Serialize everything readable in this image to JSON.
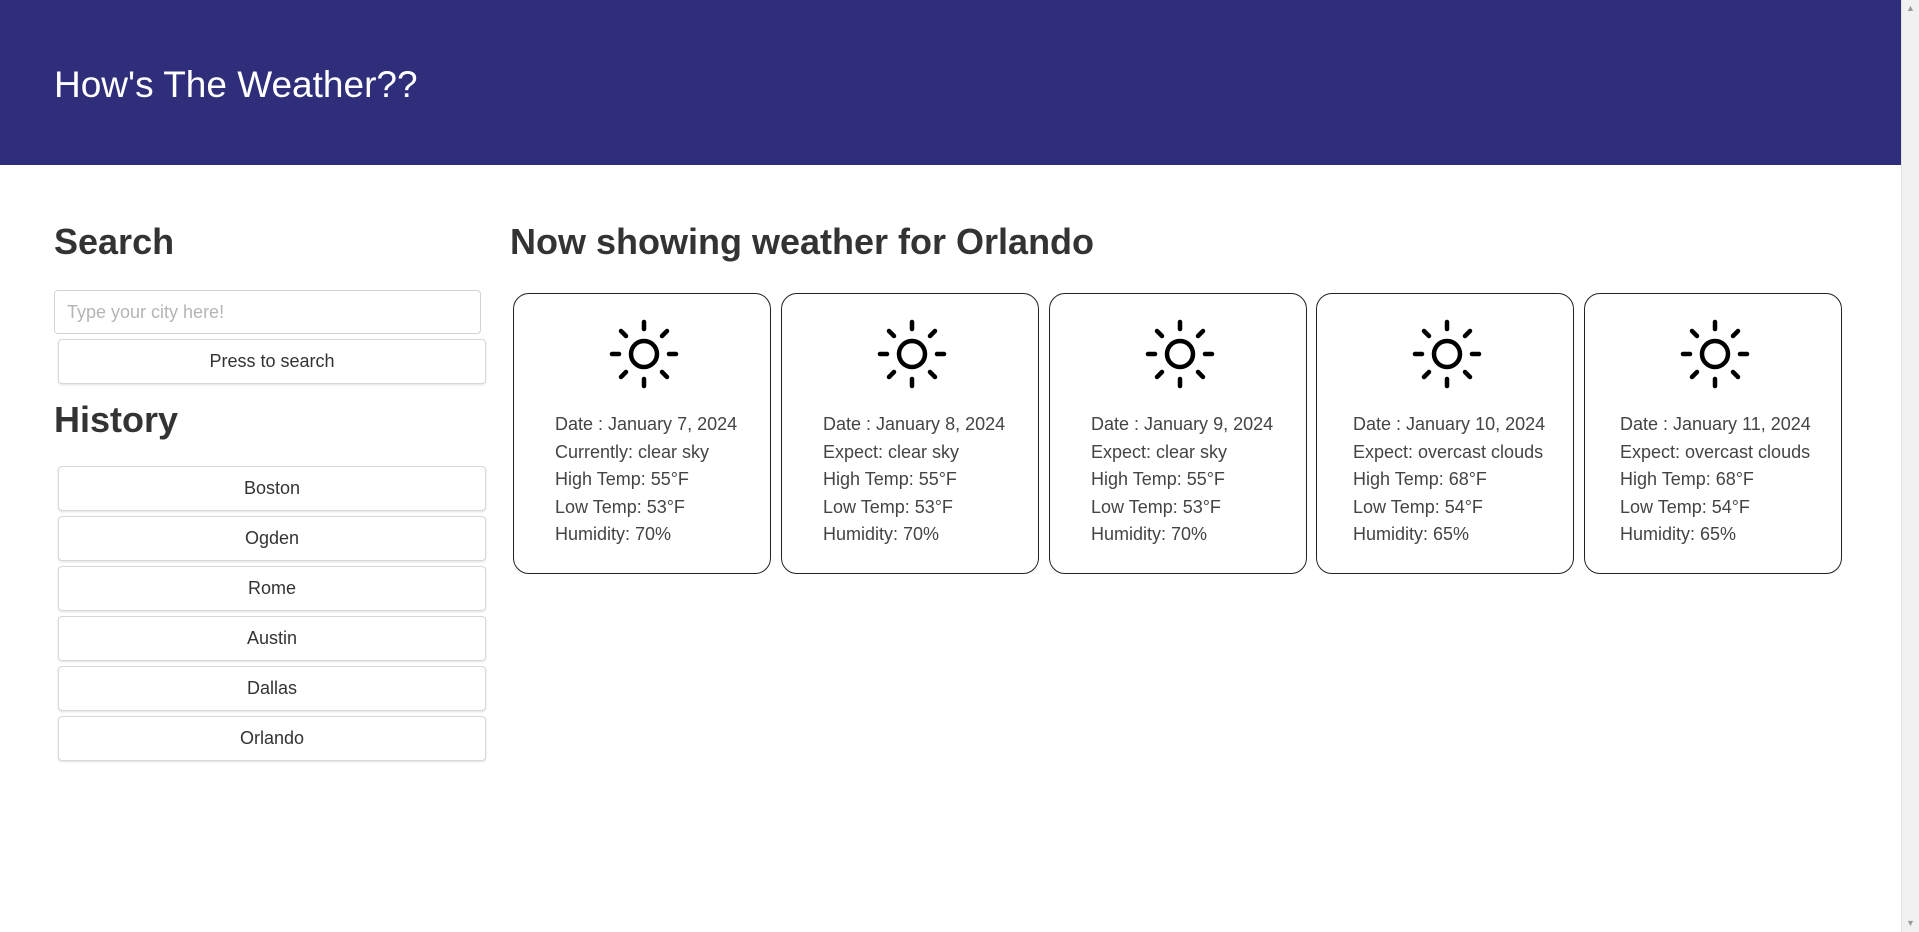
{
  "header": {
    "title": "How's The Weather??",
    "background_color": "#2f2e7b"
  },
  "search": {
    "heading": "Search",
    "placeholder": "Type your city here!",
    "value": "",
    "button_label": "Press to search"
  },
  "history": {
    "heading": "History",
    "items": [
      {
        "label": "Boston"
      },
      {
        "label": "Ogden"
      },
      {
        "label": "Rome"
      },
      {
        "label": "Austin"
      },
      {
        "label": "Dallas"
      },
      {
        "label": "Orlando"
      }
    ]
  },
  "results": {
    "heading": "Now showing weather for Orlando"
  },
  "forecast": [
    {
      "icon": "sun-icon",
      "date": "Date : January 7, 2024",
      "condition": "Currently: clear sky",
      "high": "High Temp: 55°F",
      "low": "Low Temp: 53°F",
      "humidity": "Humidity: 70%"
    },
    {
      "icon": "sun-icon",
      "date": "Date : January 8, 2024",
      "condition": "Expect: clear sky",
      "high": "High Temp: 55°F",
      "low": "Low Temp: 53°F",
      "humidity": "Humidity: 70%"
    },
    {
      "icon": "sun-icon",
      "date": "Date : January 9, 2024",
      "condition": "Expect: clear sky",
      "high": "High Temp: 55°F",
      "low": "Low Temp: 53°F",
      "humidity": "Humidity: 70%"
    },
    {
      "icon": "sun-icon",
      "date": "Date : January 10, 2024",
      "condition": "Expect: overcast clouds",
      "high": "High Temp: 68°F",
      "low": "Low Temp: 54°F",
      "humidity": "Humidity: 65%"
    },
    {
      "icon": "sun-icon",
      "date": "Date : January 11, 2024",
      "condition": "Expect: overcast clouds",
      "high": "High Temp: 68°F",
      "low": "Low Temp: 54°F",
      "humidity": "Humidity: 65%"
    }
  ]
}
